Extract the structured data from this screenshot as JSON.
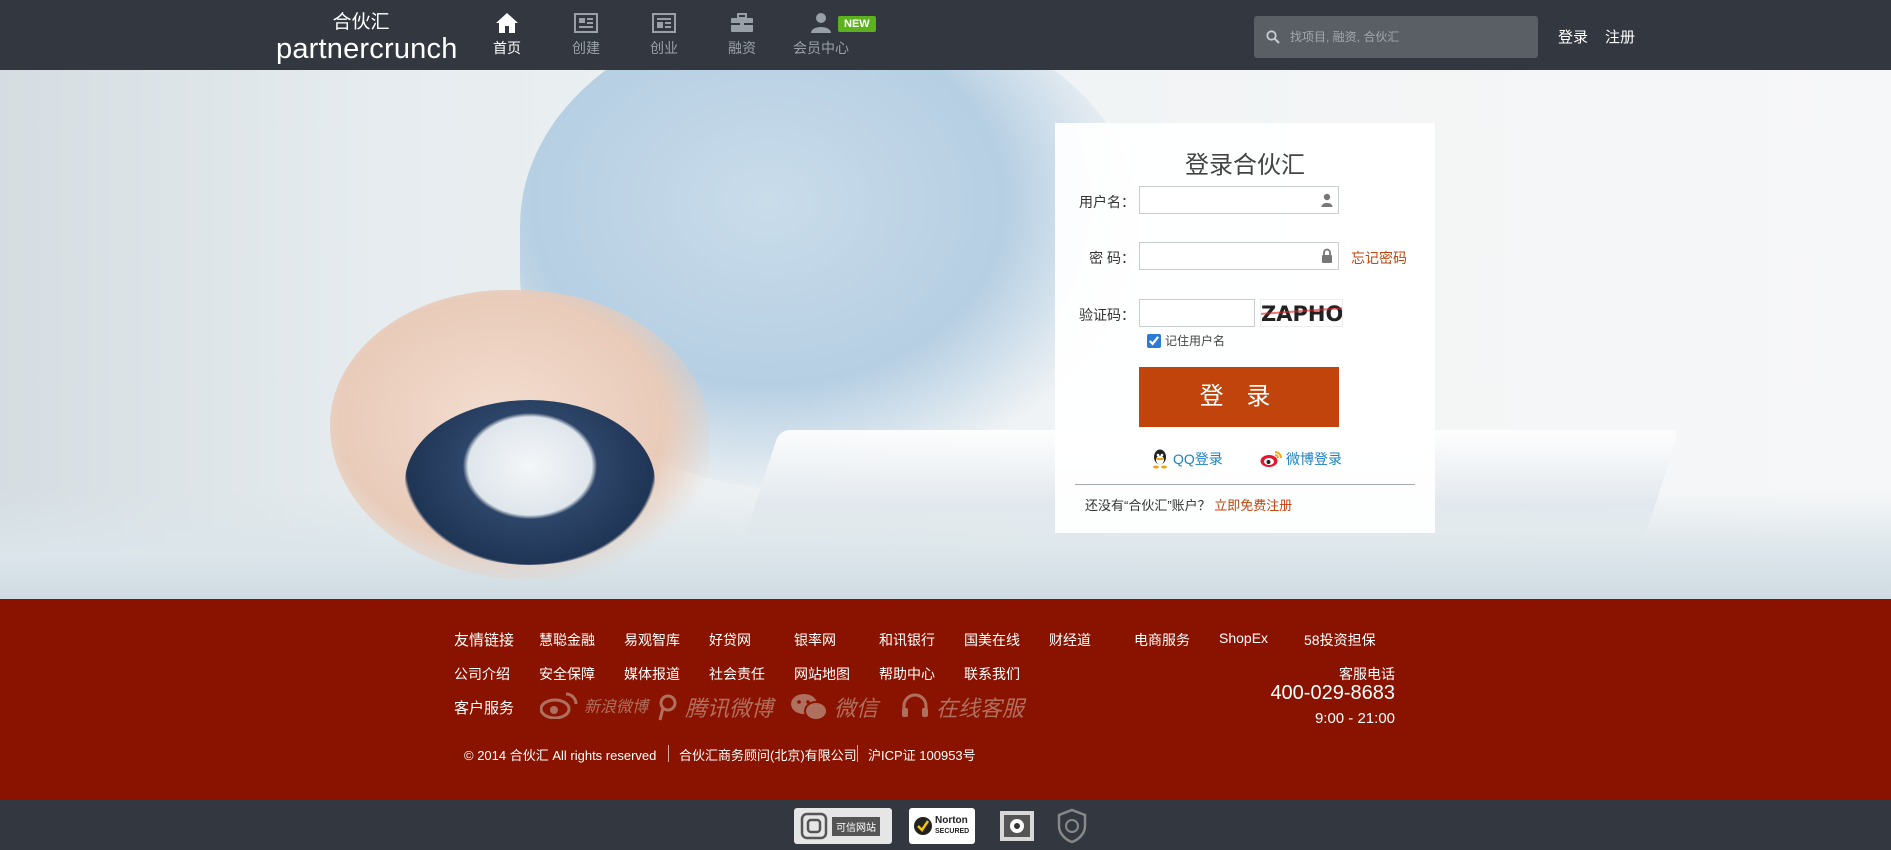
{
  "header": {
    "logo_cn": "合伙汇",
    "logo_en": "partnercrunch",
    "nav": [
      {
        "label": "首页",
        "icon": "home-icon",
        "active": true
      },
      {
        "label": "创建",
        "icon": "newspaper-icon",
        "active": false
      },
      {
        "label": "创业",
        "icon": "document-icon",
        "active": false
      },
      {
        "label": "融资",
        "icon": "briefcase-icon",
        "active": false
      },
      {
        "label": "会员中心",
        "icon": "user-icon",
        "active": false
      }
    ],
    "new_badge": "NEW",
    "search_placeholder": "找项目, 融资, 合伙汇",
    "login_link": "登录",
    "register_link": "注册"
  },
  "login": {
    "title": "登录合伙汇",
    "username_label": "用户名：",
    "password_label": "密  码：",
    "captcha_label": "验证码：",
    "forgot_password": "忘记密码",
    "captcha_text": "ZAPHOT",
    "remember_label": "记住用户名",
    "remember_checked": true,
    "submit": "登 录",
    "qq_login": "QQ登录",
    "weibo_login": "微博登录",
    "no_account": "还没有“合伙汇”账户？",
    "register_free": "立即免费注册"
  },
  "footer": {
    "friend_links_label": "友情链接",
    "friend_links": [
      "慧聪金融",
      "易观智库",
      "好贷网",
      "银率网",
      "和讯银行",
      "国美在线",
      "财经道",
      "电商服务",
      "ShopEx",
      "58投资担保"
    ],
    "info_links": [
      "公司介绍",
      "安全保障",
      "媒体报道",
      "社会责任",
      "网站地图",
      "帮助中心",
      "联系我们"
    ],
    "customer_service_label": "客户服务",
    "services": [
      "新浪微博",
      "腾讯微博",
      "微信",
      "在线客服"
    ],
    "phone_label": "客服电话",
    "phone": "400-029-8683",
    "hours": "9:00 - 21:00",
    "copyright": "© 2014 合伙汇 All rights reserved",
    "company": "合伙汇商务顾问(北京)有限公司",
    "icp": "沪ICP证 100953号"
  },
  "badges": {
    "trusted_site": "可信网站",
    "norton_line1": "Norton",
    "norton_line2": "SECURED"
  },
  "colors": {
    "topbar": "#333840",
    "accent": "#c0440c",
    "footer": "#8a1300",
    "link_blue": "#1d83c5",
    "badge_green": "#5cb21d"
  }
}
